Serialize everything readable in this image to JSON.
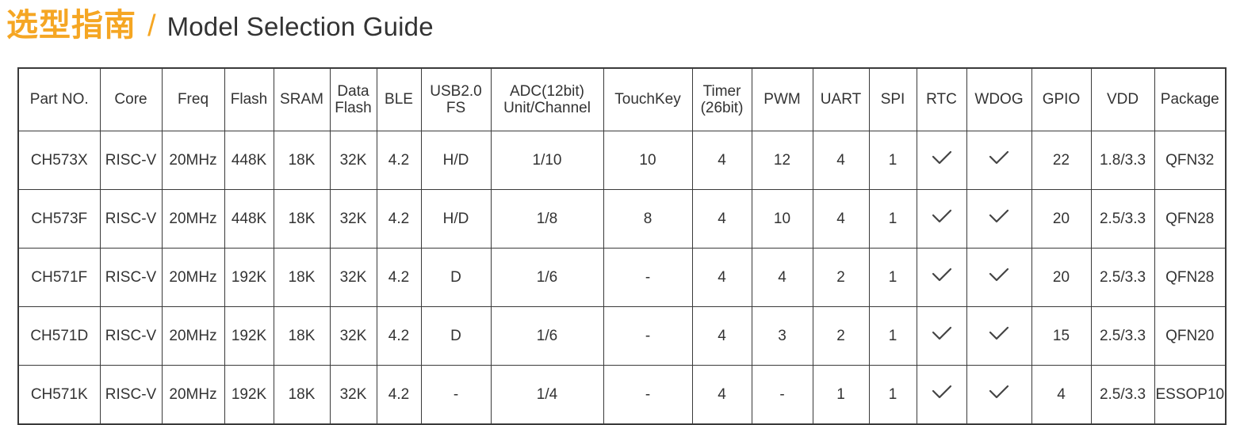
{
  "header": {
    "title_cn": "选型指南",
    "separator": "\\",
    "title_en": "Model Selection Guide",
    "accent_color": "#F5A623",
    "text_color": "#333333"
  },
  "table": {
    "columns": [
      {
        "id": "part-no",
        "label": "Part NO."
      },
      {
        "id": "core",
        "label": "Core"
      },
      {
        "id": "freq",
        "label": "Freq"
      },
      {
        "id": "flash",
        "label": "Flash"
      },
      {
        "id": "sram",
        "label": "SRAM"
      },
      {
        "id": "data-flash",
        "label": "Data",
        "label2": "Flash"
      },
      {
        "id": "ble",
        "label": "BLE"
      },
      {
        "id": "usb",
        "label": "USB2.0",
        "label2": "FS"
      },
      {
        "id": "adc",
        "label": "ADC(12bit)",
        "label2": "Unit/Channel"
      },
      {
        "id": "touchkey",
        "label": "TouchKey"
      },
      {
        "id": "timer",
        "label": "Timer",
        "label2": "(26bit)"
      },
      {
        "id": "pwm",
        "label": "PWM"
      },
      {
        "id": "uart",
        "label": "UART"
      },
      {
        "id": "spi",
        "label": "SPI"
      },
      {
        "id": "rtc",
        "label": "RTC"
      },
      {
        "id": "wdog",
        "label": "WDOG"
      },
      {
        "id": "gpio",
        "label": "GPIO"
      },
      {
        "id": "vdd",
        "label": "VDD"
      },
      {
        "id": "package",
        "label": "Package"
      }
    ],
    "rows": [
      {
        "part_no": "CH573X",
        "core": "RISC-V",
        "freq": "20MHz",
        "flash": "448K",
        "sram": "18K",
        "data_flash": "32K",
        "ble": "4.2",
        "usb": "H/D",
        "adc": "1/10",
        "touchkey": "10",
        "timer": "4",
        "pwm": "12",
        "uart": "4",
        "spi": "1",
        "rtc": "check",
        "wdog": "check",
        "gpio": "22",
        "vdd": "1.8/3.3",
        "package": "QFN32"
      },
      {
        "part_no": "CH573F",
        "core": "RISC-V",
        "freq": "20MHz",
        "flash": "448K",
        "sram": "18K",
        "data_flash": "32K",
        "ble": "4.2",
        "usb": "H/D",
        "adc": "1/8",
        "touchkey": "8",
        "timer": "4",
        "pwm": "10",
        "uart": "4",
        "spi": "1",
        "rtc": "check",
        "wdog": "check",
        "gpio": "20",
        "vdd": "2.5/3.3",
        "package": "QFN28"
      },
      {
        "part_no": "CH571F",
        "core": "RISC-V",
        "freq": "20MHz",
        "flash": "192K",
        "sram": "18K",
        "data_flash": "32K",
        "ble": "4.2",
        "usb": "D",
        "adc": "1/6",
        "touchkey": "-",
        "timer": "4",
        "pwm": "4",
        "uart": "2",
        "spi": "1",
        "rtc": "check",
        "wdog": "check",
        "gpio": "20",
        "vdd": "2.5/3.3",
        "package": "QFN28"
      },
      {
        "part_no": "CH571D",
        "core": "RISC-V",
        "freq": "20MHz",
        "flash": "192K",
        "sram": "18K",
        "data_flash": "32K",
        "ble": "4.2",
        "usb": "D",
        "adc": "1/6",
        "touchkey": "-",
        "timer": "4",
        "pwm": "3",
        "uart": "2",
        "spi": "1",
        "rtc": "check",
        "wdog": "check",
        "gpio": "15",
        "vdd": "2.5/3.3",
        "package": "QFN20"
      },
      {
        "part_no": "CH571K",
        "core": "RISC-V",
        "freq": "20MHz",
        "flash": "192K",
        "sram": "18K",
        "data_flash": "32K",
        "ble": "4.2",
        "usb": "-",
        "adc": "1/4",
        "touchkey": "-",
        "timer": "4",
        "pwm": "-",
        "uart": "1",
        "spi": "1",
        "rtc": "check",
        "wdog": "check",
        "gpio": "4",
        "vdd": "2.5/3.3",
        "package": "ESSOP10"
      }
    ]
  }
}
